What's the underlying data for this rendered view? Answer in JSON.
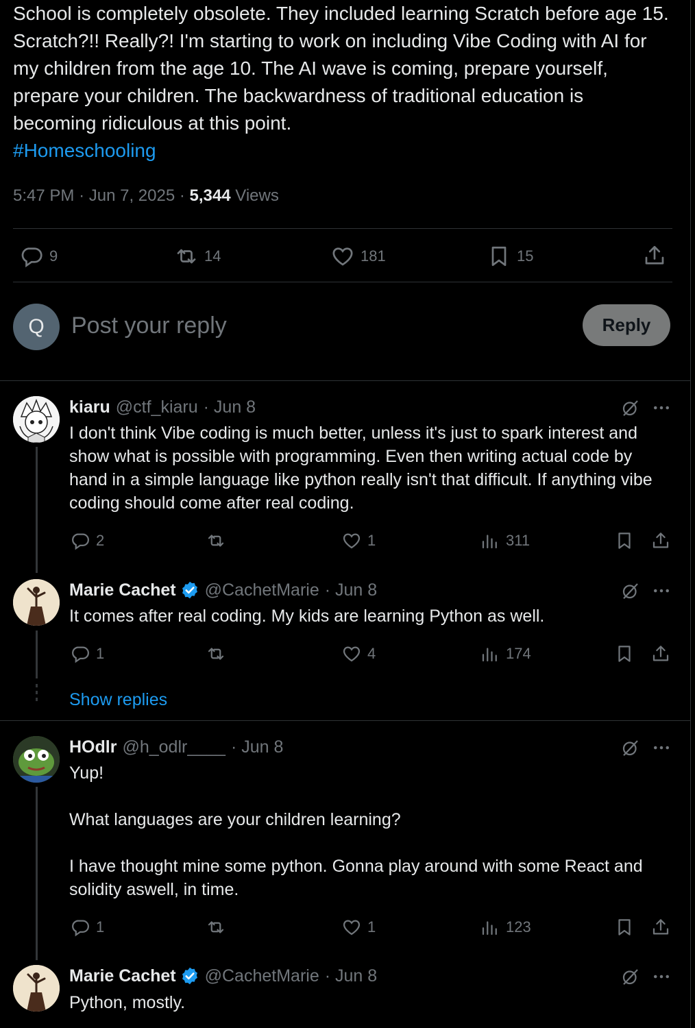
{
  "post": {
    "text": "School is completely obsolete. They included learning Scratch before age 15. Scratch?!! Really?! I'm starting to work on including Vibe Coding with AI for my children from the age 10. The AI wave is coming, prepare yourself, prepare your children. The backwardness of traditional education is becoming ridiculous at this point.",
    "hashtag": "#Homeschooling",
    "time": "5:47 PM",
    "date": "Jun 7, 2025",
    "views": "5,344",
    "views_label": "Views",
    "sep": "·",
    "stats": {
      "replies": "9",
      "reposts": "14",
      "likes": "181",
      "bookmarks": "15"
    }
  },
  "composer": {
    "avatar_letter": "Q",
    "placeholder": "Post your reply",
    "button": "Reply"
  },
  "replies": [
    {
      "name": "kiaru",
      "handle": "@ctf_kiaru",
      "date": "· Jun 8",
      "verified": false,
      "text": "I don't think Vibe coding is much better, unless it's just to spark interest and show what is possible with programming. Even then writing actual code by hand in a simple language like python really isn't that difficult. If anything vibe coding should come after real coding.",
      "replies": "2",
      "reposts": "",
      "likes": "1",
      "views": "311"
    },
    {
      "name": "Marie Cachet",
      "handle": "@CachetMarie",
      "date": "· Jun 8",
      "verified": true,
      "text": "It comes after real coding. My kids are learning Python as well.",
      "replies": "1",
      "reposts": "",
      "likes": "4",
      "views": "174"
    },
    {
      "name": "HOdlr",
      "handle": "@h_odlr____",
      "date": "· Jun 8",
      "verified": false,
      "text_lines": [
        "Yup!",
        "What languages are your children learning?",
        "I have thought mine some python. Gonna play around with some React and solidity aswell, in time."
      ],
      "replies": "1",
      "reposts": "",
      "likes": "1",
      "views": "123"
    },
    {
      "name": "Marie Cachet",
      "handle": "@CachetMarie",
      "date": "· Jun 8",
      "verified": true,
      "text": "Python, mostly."
    }
  ],
  "show_replies": "Show replies",
  "colors": {
    "accent": "#1d9bf0",
    "muted": "#71767b",
    "text": "#e7e9ea",
    "divider": "#2f3336"
  }
}
